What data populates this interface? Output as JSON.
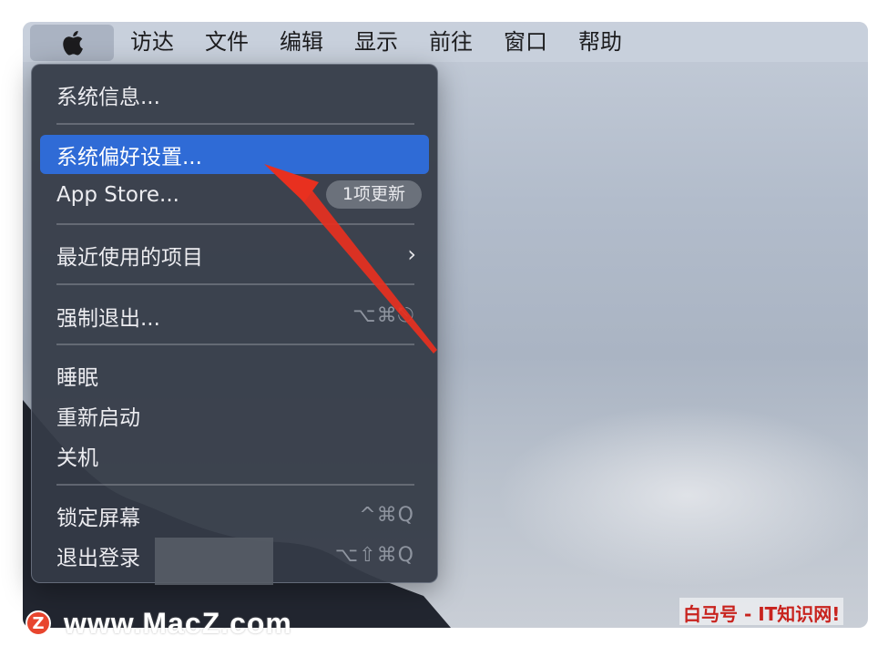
{
  "menubar": {
    "apple_icon": "apple-logo-icon",
    "items": [
      "访达",
      "文件",
      "编辑",
      "显示",
      "前往",
      "窗口",
      "帮助"
    ]
  },
  "apple_menu": {
    "items": [
      {
        "label": "系统信息..."
      },
      {
        "label": "系统偏好设置...",
        "selected": true
      },
      {
        "label": "App Store...",
        "badge": "1项更新"
      },
      {
        "label": "最近使用的项目",
        "submenu_icon": "chevron-right-icon"
      },
      {
        "label": "强制退出...",
        "shortcut": "⌥⌘⎋"
      },
      {
        "label": "睡眠"
      },
      {
        "label": "重新启动"
      },
      {
        "label": "关机"
      },
      {
        "label": "锁定屏幕",
        "shortcut": "^⌘Q"
      },
      {
        "label": "退出登录",
        "shortcut": "⌥⇧⌘Q"
      }
    ]
  },
  "watermarks": {
    "left_logo": "Z",
    "left_text": "www.MacZ.com",
    "right_text": "白马号 - IT知识网!"
  },
  "colors": {
    "selection": "#2f6bd6",
    "annotation_arrow": "#e8301f"
  }
}
